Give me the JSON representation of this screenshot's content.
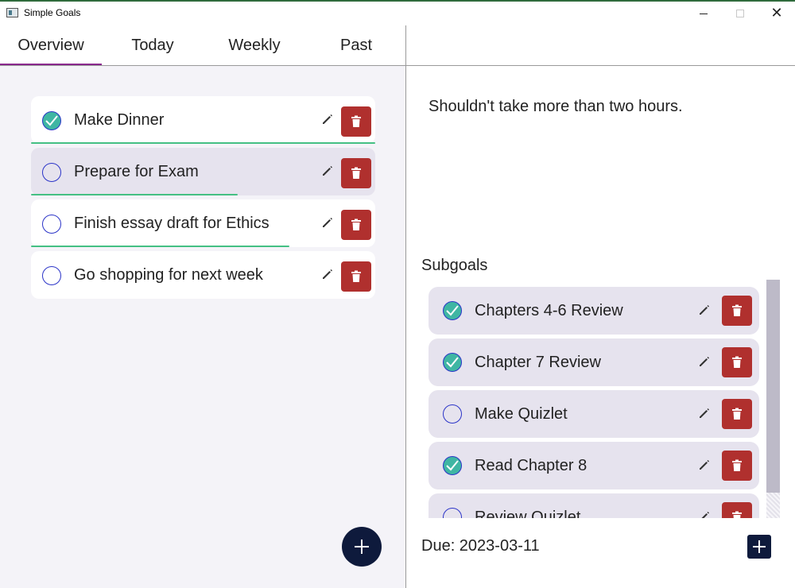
{
  "window": {
    "title": "Simple Goals"
  },
  "tabs": [
    {
      "label": "Overview",
      "active": true
    },
    {
      "label": "Today",
      "active": false
    },
    {
      "label": "Weekly",
      "active": false
    },
    {
      "label": "Past",
      "active": false
    }
  ],
  "goals": [
    {
      "label": "Make Dinner",
      "done": true,
      "progress": 1.0,
      "selected": false
    },
    {
      "label": "Prepare for Exam",
      "done": false,
      "progress": 0.6,
      "selected": true
    },
    {
      "label": "Finish essay draft for Ethics",
      "done": false,
      "progress": 0.75,
      "selected": false
    },
    {
      "label": "Go shopping for next week",
      "done": false,
      "progress": 0.0,
      "selected": false
    }
  ],
  "detail": {
    "description": "Shouldn't take more than two hours.",
    "subgoals_title": "Subgoals",
    "subgoals": [
      {
        "label": "Chapters 4-6 Review",
        "done": true
      },
      {
        "label": "Chapter 7 Review",
        "done": true
      },
      {
        "label": "Make Quizlet",
        "done": false
      },
      {
        "label": "Read Chapter 8",
        "done": true
      },
      {
        "label": "Review Quizlet",
        "done": false
      }
    ],
    "due": "Due: 2023-03-11"
  },
  "icons": {
    "check": "checkmark-icon",
    "edit": "pencil-icon",
    "delete": "trash-icon",
    "add": "plus-icon"
  },
  "colors": {
    "accent_tab": "#8a2a8e",
    "progress": "#44c083",
    "delete": "#b0302e",
    "fab": "#0e1a3c",
    "check_done": "#3fb6a3",
    "check_ring": "#2b34c8"
  }
}
